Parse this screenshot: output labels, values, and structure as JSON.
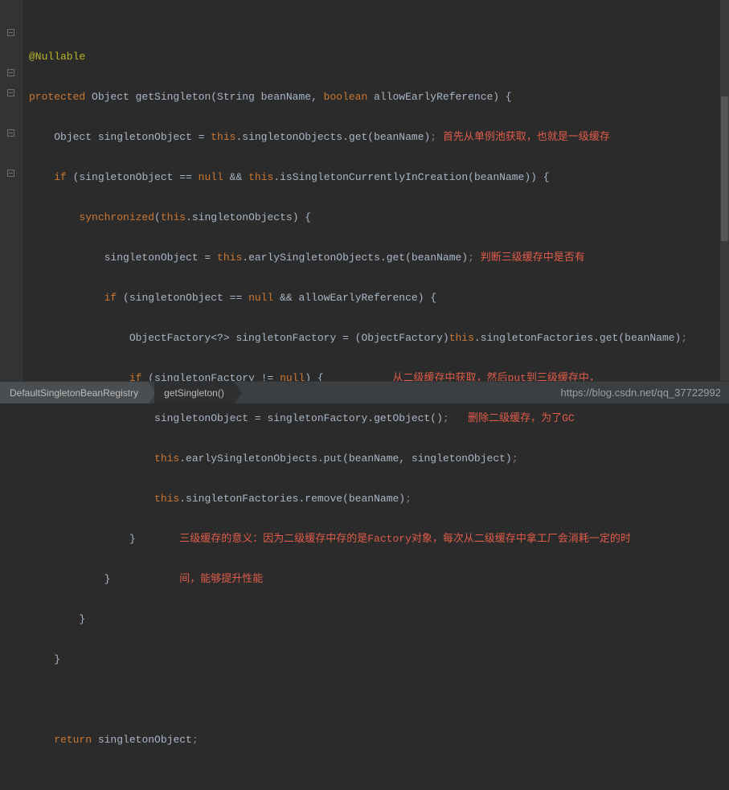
{
  "colors": {
    "bg": "#2b2b2b",
    "keyword": "#cc7832",
    "annotation": "#bbb529",
    "comment_red": "#e05c4a",
    "text": "#a9b7c6"
  },
  "code": {
    "annotation": "@Nullable",
    "kw_protected": "protected",
    "ret_type": " Object getSingleton(String beanName, ",
    "kw_boolean": "boolean",
    "sig_tail": " allowEarlyReference) {",
    "l3_a": "    Object singletonObject = ",
    "kw_this": "this",
    "l3_b": ".singletonObjects.get(beanName)",
    "semi": ";",
    "c3": " 首先从单例池获取，也就是一级缓存",
    "l4_a": "    ",
    "kw_if": "if",
    "l4_b": " (singletonObject == ",
    "kw_null": "null",
    "l4_c": " && ",
    "l4_d": ".isSingletonCurrentlyInCreation(beanName)) {",
    "l5_a": "        ",
    "kw_sync": "synchronized",
    "l5_b": "(",
    "l5_c": ".singletonObjects) {",
    "l6_a": "            singletonObject = ",
    "l6_b": ".earlySingletonObjects.get(beanName)",
    "c6": " 判断三级缓存中是否有",
    "l7_a": "            ",
    "l7_b": " (singletonObject == ",
    "l7_c": " && allowEarlyReference) {",
    "l8_a": "                ObjectFactory<?> singletonFactory = (ObjectFactory)",
    "l8_b": ".singletonFactories.get(beanName)",
    "l9_a": "                ",
    "l9_b": " (singletonFactory != ",
    "l9_c": ") {",
    "c9a": "从二级缓存中获取，然后put到三级缓存中，",
    "l10_a": "                    singletonObject = singletonFactory.getObject()",
    "c10": "删除二级缓存，为了GC",
    "l11_a": "                    ",
    "l11_b": ".earlySingletonObjects.put(beanName, singletonObject)",
    "l12_a": "                    ",
    "l12_b": ".singletonFactories.remove(beanName)",
    "l13": "                }",
    "c13a": "三级缓存的意义：因为二级缓存中存的是Factory对象，每次从二级缓存中拿工厂会消耗一定的时",
    "l14": "            }",
    "c14a": "间，能够提升性能",
    "l15": "        }",
    "l16": "    }",
    "blank": "",
    "l18_a": "    ",
    "kw_return": "return",
    "l18_b": " singletonObject",
    "sp": " "
  },
  "breadcrumbs": {
    "item1": "DefaultSingletonBeanRegistry",
    "item2": "getSingleton()"
  },
  "watermark": "https://blog.csdn.net/qq_37722992"
}
